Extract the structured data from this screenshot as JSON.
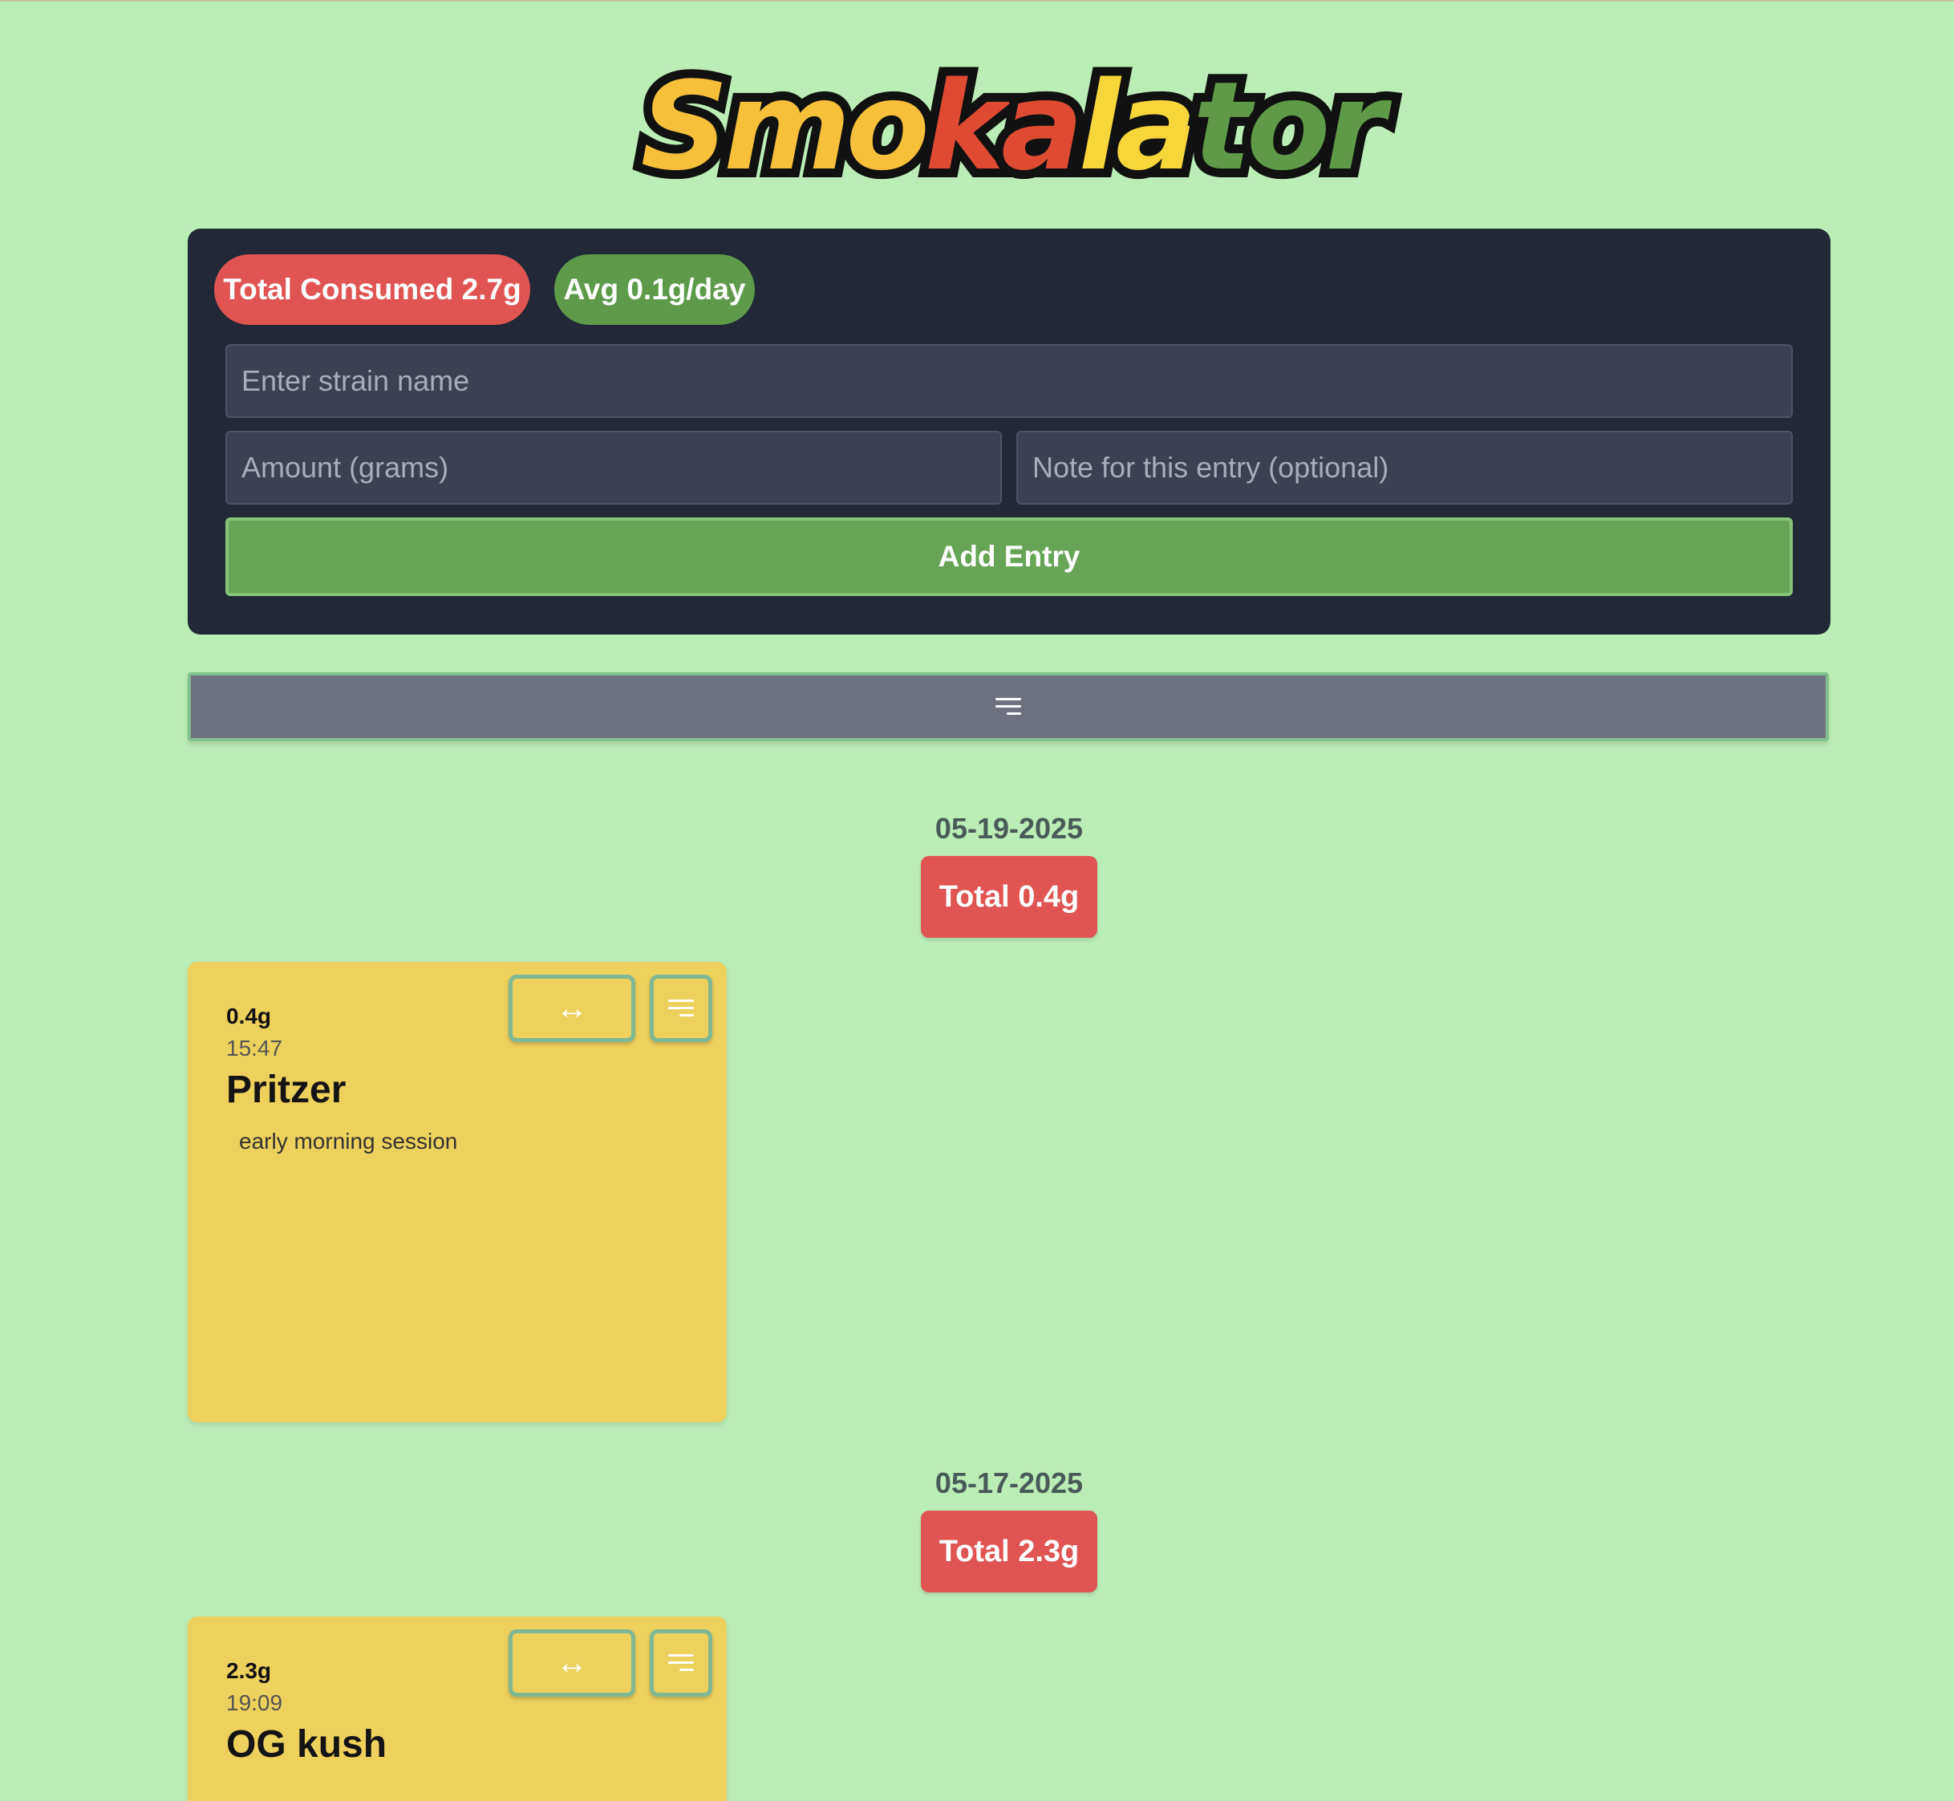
{
  "app": {
    "logo_letters": [
      {
        "char": "S",
        "color": "#f6c03a"
      },
      {
        "char": "m",
        "color": "#f6c03a"
      },
      {
        "char": "o",
        "color": "#f6c03a"
      },
      {
        "char": "k",
        "color": "#df4a33"
      },
      {
        "char": "a",
        "color": "#df4a33"
      },
      {
        "char": "l",
        "color": "#f6d63a"
      },
      {
        "char": "a",
        "color": "#f6d63a"
      },
      {
        "char": "t",
        "color": "#5e9a47"
      },
      {
        "char": "o",
        "color": "#5e9a47"
      },
      {
        "char": "r",
        "color": "#5e9a47"
      }
    ]
  },
  "stats": {
    "total_consumed": "Total Consumed 2.7g",
    "average": "Avg 0.1g/day"
  },
  "form": {
    "strain_placeholder": "Enter strain name",
    "amount_placeholder": "Amount (grams)",
    "note_placeholder": "Note for this entry (optional)",
    "add_button": "Add Entry"
  },
  "filter_bar": {
    "icon": "filter-lines-icon"
  },
  "days": [
    {
      "date": "05-19-2025",
      "total": "Total 0.4g",
      "entries": [
        {
          "amount": "0.4g",
          "time": "15:47",
          "strain": "Pritzer",
          "note": "early morning session"
        }
      ]
    },
    {
      "date": "05-17-2025",
      "total": "Total 2.3g",
      "entries": [
        {
          "amount": "2.3g",
          "time": "19:09",
          "strain": "OG kush",
          "note": ""
        }
      ]
    }
  ],
  "card_buttons": {
    "move_glyph": "↔",
    "menu_icon": "lines-icon"
  },
  "colors": {
    "background": "#bbedb6",
    "panel": "#222836",
    "total_red": "#e05552",
    "avg_green": "#5d9b4b",
    "card_yellow": "#eed05c",
    "add_button_green": "#66a555"
  }
}
